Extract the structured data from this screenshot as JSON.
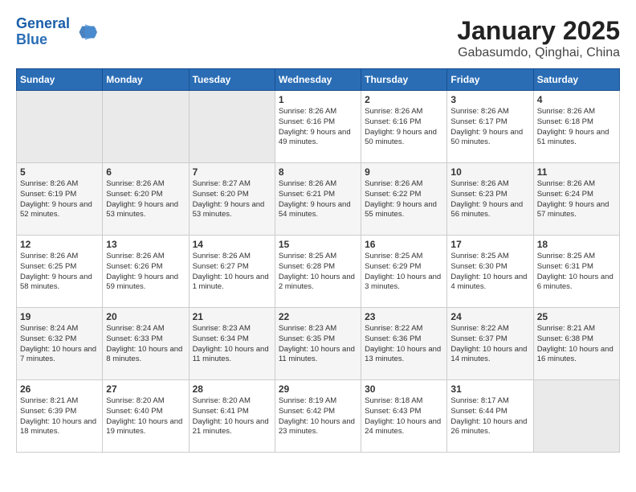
{
  "logo": {
    "line1": "General",
    "line2": "Blue"
  },
  "title": "January 2025",
  "subtitle": "Gabasumdo, Qinghai, China",
  "days_of_week": [
    "Sunday",
    "Monday",
    "Tuesday",
    "Wednesday",
    "Thursday",
    "Friday",
    "Saturday"
  ],
  "weeks": [
    [
      {
        "day": "",
        "empty": true
      },
      {
        "day": "",
        "empty": true
      },
      {
        "day": "",
        "empty": true
      },
      {
        "day": "1",
        "text": "Sunrise: 8:26 AM\nSunset: 6:16 PM\nDaylight: 9 hours and 49 minutes."
      },
      {
        "day": "2",
        "text": "Sunrise: 8:26 AM\nSunset: 6:16 PM\nDaylight: 9 hours and 50 minutes."
      },
      {
        "day": "3",
        "text": "Sunrise: 8:26 AM\nSunset: 6:17 PM\nDaylight: 9 hours and 50 minutes."
      },
      {
        "day": "4",
        "text": "Sunrise: 8:26 AM\nSunset: 6:18 PM\nDaylight: 9 hours and 51 minutes."
      }
    ],
    [
      {
        "day": "5",
        "text": "Sunrise: 8:26 AM\nSunset: 6:19 PM\nDaylight: 9 hours and 52 minutes."
      },
      {
        "day": "6",
        "text": "Sunrise: 8:26 AM\nSunset: 6:20 PM\nDaylight: 9 hours and 53 minutes."
      },
      {
        "day": "7",
        "text": "Sunrise: 8:27 AM\nSunset: 6:20 PM\nDaylight: 9 hours and 53 minutes."
      },
      {
        "day": "8",
        "text": "Sunrise: 8:26 AM\nSunset: 6:21 PM\nDaylight: 9 hours and 54 minutes."
      },
      {
        "day": "9",
        "text": "Sunrise: 8:26 AM\nSunset: 6:22 PM\nDaylight: 9 hours and 55 minutes."
      },
      {
        "day": "10",
        "text": "Sunrise: 8:26 AM\nSunset: 6:23 PM\nDaylight: 9 hours and 56 minutes."
      },
      {
        "day": "11",
        "text": "Sunrise: 8:26 AM\nSunset: 6:24 PM\nDaylight: 9 hours and 57 minutes."
      }
    ],
    [
      {
        "day": "12",
        "text": "Sunrise: 8:26 AM\nSunset: 6:25 PM\nDaylight: 9 hours and 58 minutes."
      },
      {
        "day": "13",
        "text": "Sunrise: 8:26 AM\nSunset: 6:26 PM\nDaylight: 9 hours and 59 minutes."
      },
      {
        "day": "14",
        "text": "Sunrise: 8:26 AM\nSunset: 6:27 PM\nDaylight: 10 hours and 1 minute."
      },
      {
        "day": "15",
        "text": "Sunrise: 8:25 AM\nSunset: 6:28 PM\nDaylight: 10 hours and 2 minutes."
      },
      {
        "day": "16",
        "text": "Sunrise: 8:25 AM\nSunset: 6:29 PM\nDaylight: 10 hours and 3 minutes."
      },
      {
        "day": "17",
        "text": "Sunrise: 8:25 AM\nSunset: 6:30 PM\nDaylight: 10 hours and 4 minutes."
      },
      {
        "day": "18",
        "text": "Sunrise: 8:25 AM\nSunset: 6:31 PM\nDaylight: 10 hours and 6 minutes."
      }
    ],
    [
      {
        "day": "19",
        "text": "Sunrise: 8:24 AM\nSunset: 6:32 PM\nDaylight: 10 hours and 7 minutes."
      },
      {
        "day": "20",
        "text": "Sunrise: 8:24 AM\nSunset: 6:33 PM\nDaylight: 10 hours and 8 minutes."
      },
      {
        "day": "21",
        "text": "Sunrise: 8:23 AM\nSunset: 6:34 PM\nDaylight: 10 hours and 11 minutes."
      },
      {
        "day": "22",
        "text": "Sunrise: 8:23 AM\nSunset: 6:35 PM\nDaylight: 10 hours and 11 minutes."
      },
      {
        "day": "23",
        "text": "Sunrise: 8:22 AM\nSunset: 6:36 PM\nDaylight: 10 hours and 13 minutes."
      },
      {
        "day": "24",
        "text": "Sunrise: 8:22 AM\nSunset: 6:37 PM\nDaylight: 10 hours and 14 minutes."
      },
      {
        "day": "25",
        "text": "Sunrise: 8:21 AM\nSunset: 6:38 PM\nDaylight: 10 hours and 16 minutes."
      }
    ],
    [
      {
        "day": "26",
        "text": "Sunrise: 8:21 AM\nSunset: 6:39 PM\nDaylight: 10 hours and 18 minutes."
      },
      {
        "day": "27",
        "text": "Sunrise: 8:20 AM\nSunset: 6:40 PM\nDaylight: 10 hours and 19 minutes."
      },
      {
        "day": "28",
        "text": "Sunrise: 8:20 AM\nSunset: 6:41 PM\nDaylight: 10 hours and 21 minutes."
      },
      {
        "day": "29",
        "text": "Sunrise: 8:19 AM\nSunset: 6:42 PM\nDaylight: 10 hours and 23 minutes."
      },
      {
        "day": "30",
        "text": "Sunrise: 8:18 AM\nSunset: 6:43 PM\nDaylight: 10 hours and 24 minutes."
      },
      {
        "day": "31",
        "text": "Sunrise: 8:17 AM\nSunset: 6:44 PM\nDaylight: 10 hours and 26 minutes."
      },
      {
        "day": "",
        "empty": true
      }
    ]
  ]
}
